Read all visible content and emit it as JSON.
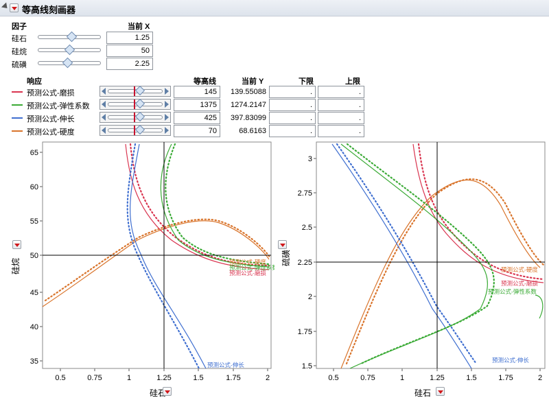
{
  "title": "等高线刻画器",
  "factors_header": "因子",
  "current_x_header": "当前 X",
  "factors": [
    {
      "name": "硅石",
      "value": "1.25",
      "slider": 0.5
    },
    {
      "name": "硅烷",
      "value": "50",
      "slider": 0.5
    },
    {
      "name": "硫磺",
      "value": "2.25",
      "slider": 0.45
    }
  ],
  "responses_header": {
    "response": "响应",
    "contour": "等高线",
    "current_y": "当前 Y",
    "lower": "下限",
    "upper": "上限"
  },
  "responses": [
    {
      "name": "预测公式-磨损",
      "color": "#d9344f",
      "contour": "145",
      "current_y": "139.55088",
      "lower": ".",
      "upper": ".",
      "slider": 0.52
    },
    {
      "name": "预测公式-弹性系数",
      "color": "#3aaa35",
      "contour": "1375",
      "current_y": "1274.2147",
      "lower": ".",
      "upper": ".",
      "slider": 0.52
    },
    {
      "name": "预测公式-伸长",
      "color": "#3f6fd0",
      "contour": "425",
      "current_y": "397.83099",
      "lower": ".",
      "upper": ".",
      "slider": 0.52
    },
    {
      "name": "预测公式-硬度",
      "color": "#d9742b",
      "contour": "70",
      "current_y": "68.6163",
      "lower": ".",
      "upper": ".",
      "slider": 0.52
    }
  ],
  "plot1": {
    "xlabel": "硅石",
    "ylabel": "硅烷",
    "xticks": [
      "0.5",
      "0.75",
      "1",
      "1.25",
      "1.5",
      "1.75",
      "2"
    ],
    "yticks": [
      "35",
      "40",
      "45",
      "50",
      "55",
      "60",
      "65"
    ],
    "labels": {
      "hard": "预测公式-硬度",
      "mod": "预测公式-弹性系数",
      "abr": "预测公式-磨损",
      "elong": "预测公式-伸长"
    }
  },
  "plot2": {
    "xlabel": "硅石",
    "ylabel": "硫磺",
    "xticks": [
      "0.5",
      "0.75",
      "1",
      "1.25",
      "1.5",
      "1.75",
      "2"
    ],
    "yticks": [
      "1.5",
      "1.75",
      "2",
      "2.25",
      "2.5",
      "2.75",
      "3"
    ],
    "labels": {
      "hard": "预测公式-硬度",
      "abr": "预测公式-磨损",
      "mod": "预测公式-弹性系数",
      "elong": "预测公式-伸长"
    }
  }
}
